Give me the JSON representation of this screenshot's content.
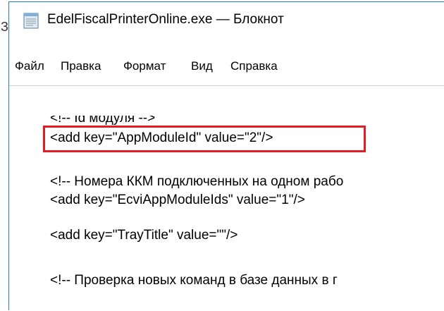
{
  "partial_left_char": "З",
  "window": {
    "title": "EdelFiscalPrinterOnline.exe — Блокнот",
    "icon": "notepad-icon"
  },
  "menu": {
    "items": [
      "Файл",
      "Правка",
      "Формат",
      "Вид",
      "Справка"
    ]
  },
  "editor": {
    "lines": [
      "<!-- Id модуля -->",
      "<add key=\"AppModuleId\" value=\"2\"/>",
      "",
      "<!-- Номера ККМ подключенных на одном рабо",
      "<add key=\"EcviAppModuleIds\" value=\"1\"/>",
      "",
      "<add key=\"TrayTitle\" value=\"\"/>",
      "",
      "<!-- Проверка новых команд в базе данных в г"
    ]
  },
  "colors": {
    "highlight": "#e31b23",
    "window_border": "#2b79c8"
  }
}
